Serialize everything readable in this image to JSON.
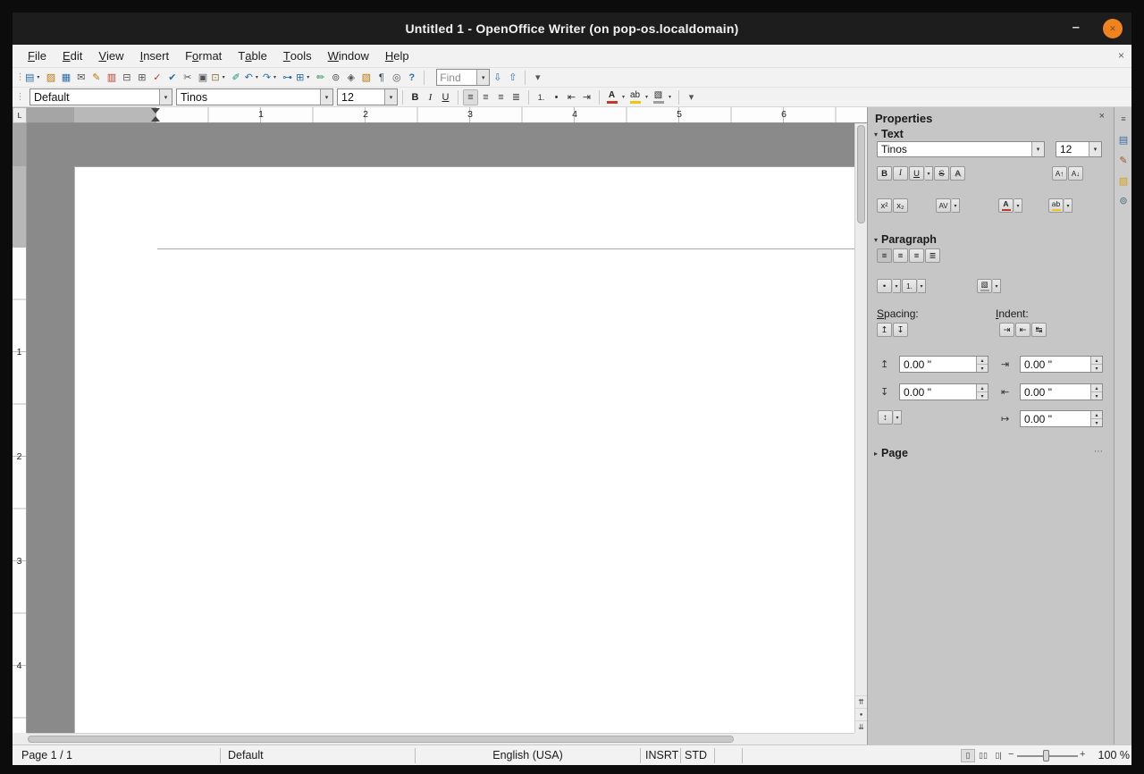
{
  "ui": {
    "dropdown": "▾",
    "spin_up": "▴",
    "spin_down": "▾",
    "grip": "⋮",
    "collapse_expanded": "▾",
    "collapse_collapsed": "▸",
    "more_options": "⋯",
    "prev_page_glyph": "⇈",
    "navigation_glyph": "●",
    "next_page_glyph": "⇊"
  },
  "titlebar": {
    "title": "Untitled 1 - OpenOffice Writer (on pop-os.localdomain)",
    "minimize_glyph": "–",
    "close_glyph": "✕"
  },
  "menubar": {
    "items": [
      {
        "pre": "",
        "accel": "F",
        "post": "ile"
      },
      {
        "pre": "",
        "accel": "E",
        "post": "dit"
      },
      {
        "pre": "",
        "accel": "V",
        "post": "iew"
      },
      {
        "pre": "",
        "accel": "I",
        "post": "nsert"
      },
      {
        "pre": "F",
        "accel": "o",
        "post": "rmat"
      },
      {
        "pre": "T",
        "accel": "a",
        "post": "ble"
      },
      {
        "pre": "",
        "accel": "T",
        "post": "ools"
      },
      {
        "pre": "",
        "accel": "W",
        "post": "indow"
      },
      {
        "pre": "",
        "accel": "H",
        "post": "elp"
      }
    ],
    "close_document_glyph": "×"
  },
  "toolbar_standard": {
    "icons": [
      {
        "name": "new-document",
        "glyph": "▤"
      },
      {
        "name": "open",
        "glyph": "▨"
      },
      {
        "name": "save",
        "glyph": "▦"
      },
      {
        "name": "document-as-email",
        "glyph": "✉"
      },
      {
        "name": "edit-file",
        "glyph": "✎"
      },
      {
        "name": "export-pdf",
        "glyph": "▥"
      },
      {
        "name": "print",
        "glyph": "⊟"
      },
      {
        "name": "page-preview",
        "glyph": "⊞"
      },
      {
        "name": "spellcheck",
        "glyph": "✓"
      },
      {
        "name": "auto-spellcheck",
        "glyph": "✔"
      },
      {
        "name": "cut",
        "glyph": "✂"
      },
      {
        "name": "copy",
        "glyph": "▣"
      },
      {
        "name": "paste",
        "glyph": "⊡"
      },
      {
        "name": "format-paintbrush",
        "glyph": "✐"
      },
      {
        "name": "undo",
        "glyph": "↶"
      },
      {
        "name": "redo",
        "glyph": "↷"
      },
      {
        "name": "hyperlink",
        "glyph": "⊶"
      },
      {
        "name": "table",
        "glyph": "⊞"
      },
      {
        "name": "show-draw-functions",
        "glyph": "✏"
      },
      {
        "name": "find-and-replace",
        "glyph": "⊚"
      },
      {
        "name": "navigator",
        "glyph": "◈"
      },
      {
        "name": "gallery",
        "glyph": "▧"
      },
      {
        "name": "nonprinting-characters",
        "glyph": "¶"
      },
      {
        "name": "zoom",
        "glyph": "◎"
      },
      {
        "name": "help",
        "glyph": "?"
      }
    ],
    "find": {
      "value": "Find",
      "next_glyph": "⇩",
      "prev_glyph": "⇧",
      "options_glyph": "▾"
    }
  },
  "toolbar_formatting": {
    "paragraph_style": "Default",
    "font_name": "Tinos",
    "font_size": "12",
    "bold_glyph": "B",
    "italic_glyph": "I",
    "underline_glyph": "U",
    "align_icons": [
      {
        "name": "align-left",
        "glyph": "≡"
      },
      {
        "name": "align-center",
        "glyph": "≡"
      },
      {
        "name": "align-right",
        "glyph": "≡"
      },
      {
        "name": "align-justify",
        "glyph": "≣"
      }
    ],
    "numbering_glyph": "1.",
    "bullets_glyph": "•",
    "decrease_indent_glyph": "⇤",
    "increase_indent_glyph": "⇥",
    "font_color_glyph": "A",
    "highlighting_glyph": "ab",
    "background_glyph": "▧",
    "font_color_hex": "#c0392b",
    "highlight_hex": "#f1c40f",
    "background_hex": "#9aa0a6"
  },
  "ruler": {
    "h_labels": [
      "1",
      "2",
      "3",
      "4",
      "5",
      "6"
    ],
    "v_labels": [
      "1",
      "2",
      "3",
      "4"
    ],
    "tab_selector_glyph": "L"
  },
  "sidebar": {
    "title": "Properties",
    "close_glyph": "×",
    "tabs": [
      {
        "name": "sidebar-menu",
        "glyph": "≡"
      },
      {
        "name": "properties-tab",
        "glyph": "▤"
      },
      {
        "name": "styles-tab",
        "glyph": "✎"
      },
      {
        "name": "gallery-tab",
        "glyph": "▧"
      },
      {
        "name": "navigator-tab",
        "glyph": "⊚"
      }
    ],
    "text_section": {
      "title": "Text",
      "font_name": "Tinos",
      "font_size": "12",
      "bold_glyph": "B",
      "italic_glyph": "I",
      "underline_glyph": "U",
      "strikethrough_glyph": "S",
      "shadow_glyph": "A",
      "increase_font_glyph": "A↑",
      "decrease_font_glyph": "A↓",
      "superscript_glyph": "x²",
      "subscript_glyph": "x₂",
      "char_spacing_glyph": "AV",
      "font_color_glyph": "A",
      "highlighting_glyph": "ab"
    },
    "paragraph_section": {
      "title": "Paragraph",
      "spacing_label": {
        "accel": "S",
        "rest": "pacing:"
      },
      "indent_label": {
        "accel": "I",
        "rest": "ndent:"
      },
      "bullets_glyph": "•",
      "numbering_glyph": "1.",
      "background_glyph": "▧",
      "increase_spacing_glyph": "↥",
      "decrease_spacing_glyph": "↧",
      "increase_indent_glyph": "⇥",
      "decrease_indent_glyph": "⇤",
      "hanging_indent_glyph": "↹",
      "line_spacing_glyph": "↕",
      "above_spacing_icon": "↥",
      "below_spacing_icon": "↧",
      "before_indent_icon": "⇥",
      "after_indent_icon": "⇤",
      "first_line_indent_icon": "↦",
      "fields": {
        "above_spacing": "0.00 \"",
        "below_spacing": "0.00 \"",
        "before_indent": "0.00 \"",
        "after_indent": "0.00 \"",
        "first_line_indent": "0.00 \""
      }
    },
    "page_section": {
      "title": "Page"
    }
  },
  "statusbar": {
    "page": "Page 1 / 1",
    "style": "Default",
    "language": "English (USA)",
    "insert_mode": "INSRT",
    "selection_mode": "STD",
    "zoom_out_glyph": "−",
    "zoom_in_glyph": "+",
    "zoom_value": "100 %",
    "view_layout_icons": [
      {
        "name": "single-page-view",
        "glyph": "▯"
      },
      {
        "name": "multi-page-view",
        "glyph": "▯▯"
      },
      {
        "name": "book-view",
        "glyph": "▯|"
      }
    ]
  }
}
